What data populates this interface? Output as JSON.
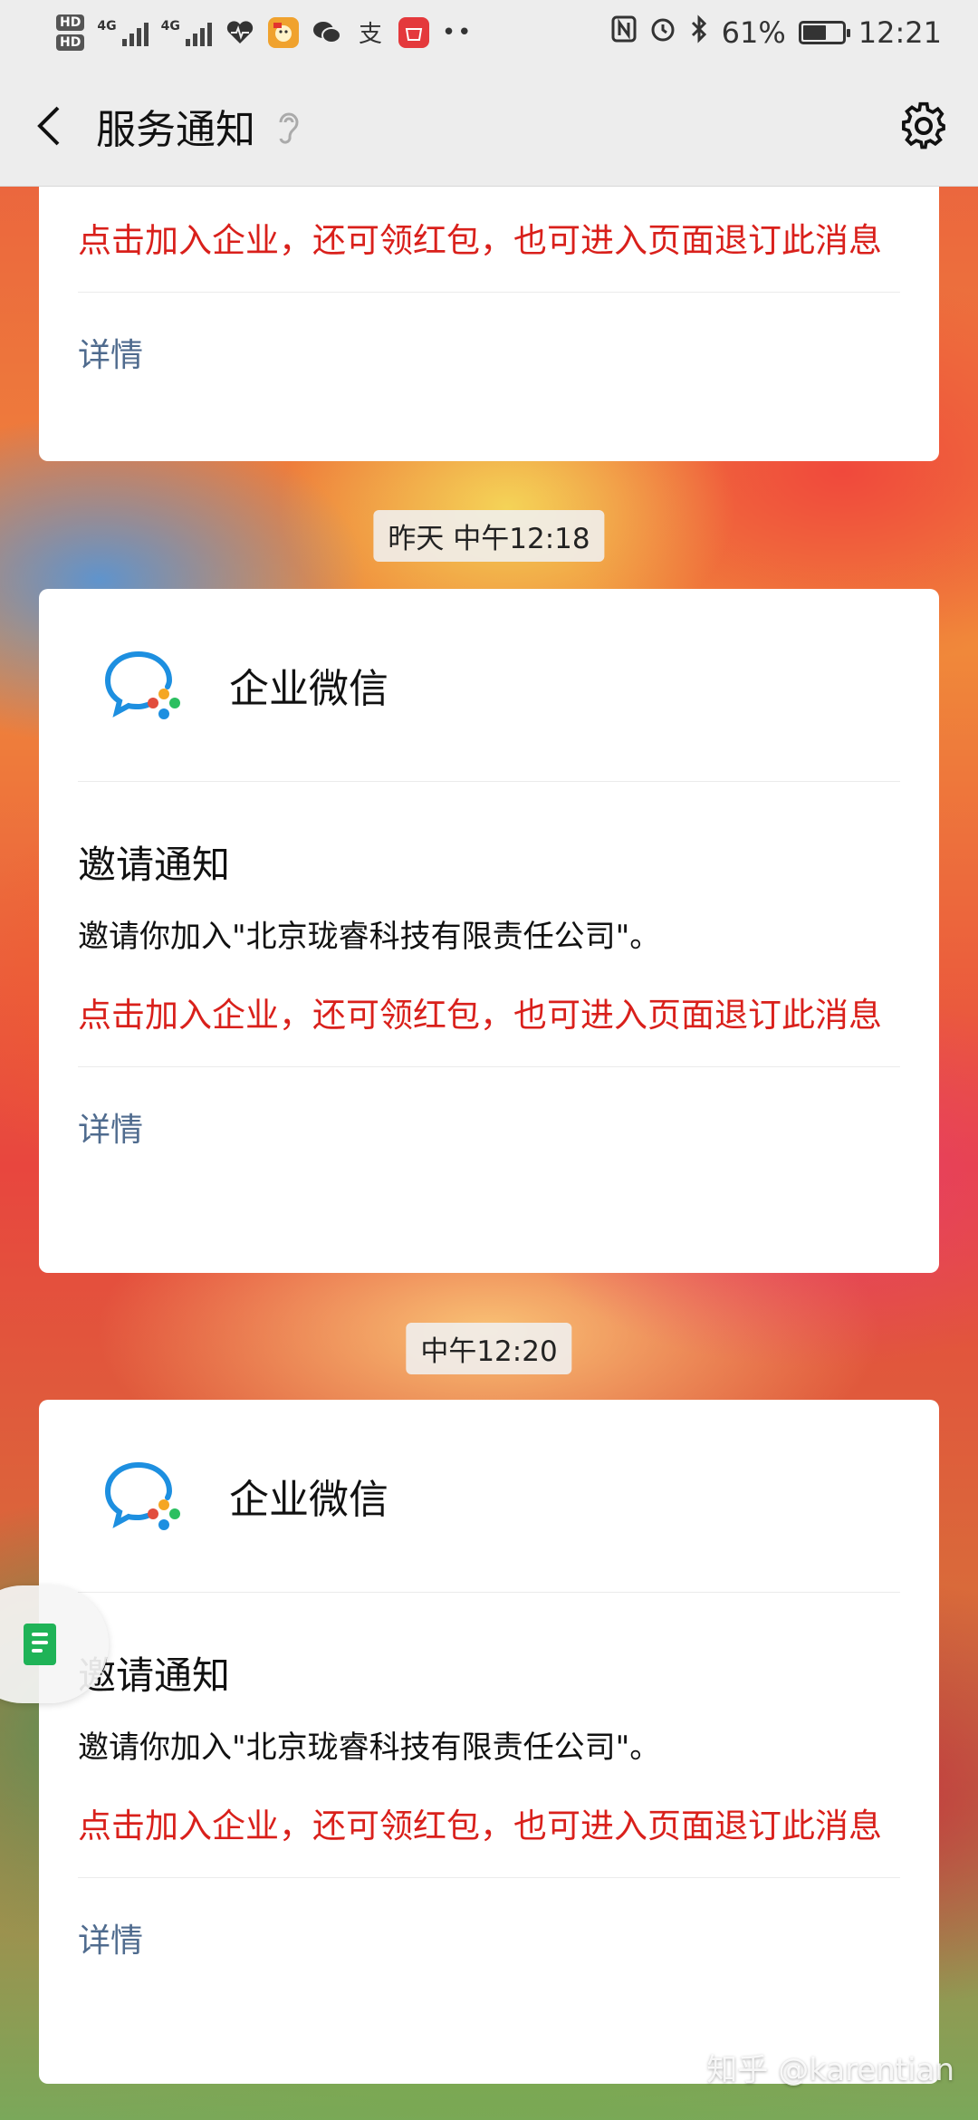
{
  "status_bar": {
    "hd_top": "HD",
    "hd_bottom": "HD",
    "net1": "4G",
    "net2": "4G",
    "battery_percent": "61%",
    "battery_level": 0.61,
    "time": "12:21",
    "icons": [
      "heart-rate-icon",
      "app-notification-icon",
      "wechat-icon",
      "alipay-icon",
      "huawei-icon",
      "more-dots-icon",
      "nfc-icon",
      "alarm-icon",
      "bluetooth-icon",
      "battery-icon"
    ]
  },
  "nav": {
    "title": "服务通知"
  },
  "partial_card": {
    "red_text": "点击加入企业，还可领红包，也可进入页面退订此消息",
    "details": "详情"
  },
  "messages": [
    {
      "time": "昨天 中午12:18",
      "app_name": "企业微信",
      "title": "邀请通知",
      "body": "邀请你加入\"北京珑睿科技有限责任公司\"。",
      "red_text": "点击加入企业，还可领红包，也可进入页面退订此消息",
      "details": "详情"
    },
    {
      "time": "中午12:20",
      "app_name": "企业微信",
      "title": "邀请通知",
      "body": "邀请你加入\"北京珑睿科技有限责任公司\"。",
      "red_text": "点击加入企业，还可领红包，也可进入页面退订此消息",
      "details": "详情"
    }
  ],
  "watermark": "知乎 @karentian",
  "colors": {
    "red_text": "#d9201b",
    "link": "#4f6b8e",
    "bar_bg": "#ededed",
    "floating_doc": "#1fb357"
  }
}
